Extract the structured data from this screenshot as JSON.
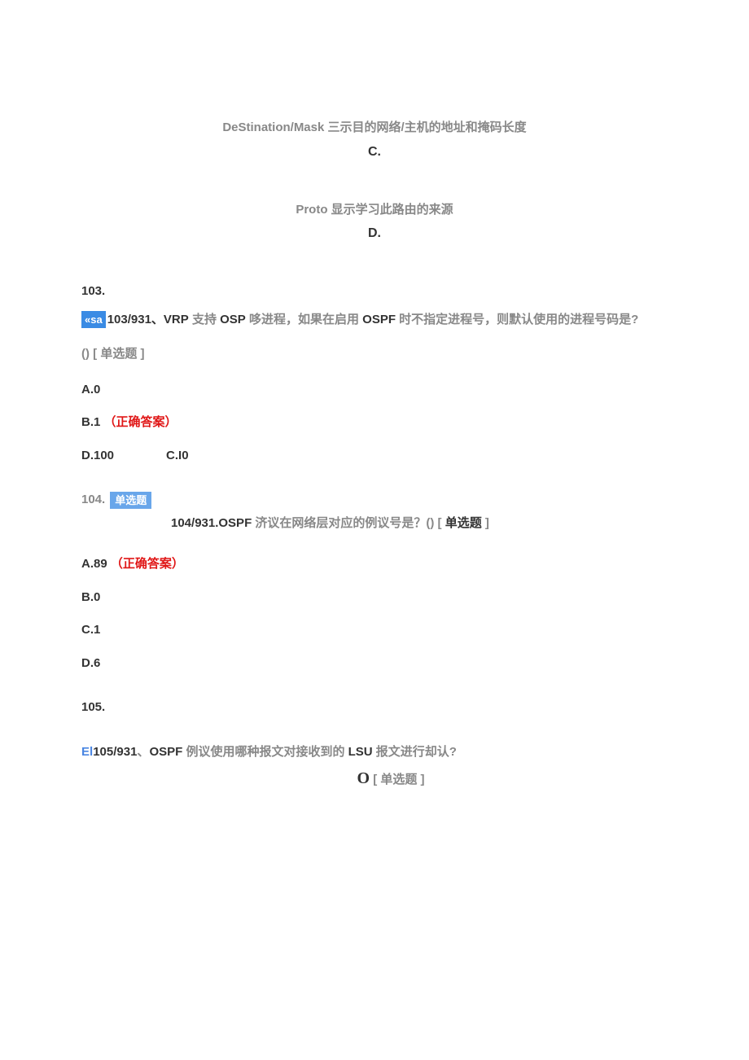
{
  "top": {
    "line1": "DeStination/Mask 三示目的网络/主机的地址和掩码长度",
    "letterC": "C.",
    "line2": "Proto 显示学习此路由的来源",
    "letterD": "D."
  },
  "q103": {
    "num": "103.",
    "tag": "«sa",
    "text_prefix": "103/931、VRP",
    "text_mid1": " 支持 ",
    "bold2": "OSP",
    "text_mid2": " 哆进程，如果在启用 ",
    "bold3": "OSPF",
    "text_tail": " 时不指定进程号，则默认使用的进程号码是?",
    "line2": "() [ 单选题 ]",
    "A": "A.0",
    "B_prefix": "B.1",
    "B_correct": "（正确答案）",
    "C": "C.I0",
    "D": "D.100"
  },
  "q104": {
    "num": "104.",
    "tag": "单选题",
    "text_bold": "104/931.OSPF",
    "text_rest": " 济议在网络层对应的例议号是？() [ ",
    "text_rest_b": "单选题",
    "text_rest_end": " ]",
    "A_prefix": "A.89",
    "A_correct": "（正确答案）",
    "B": "B.0",
    "C": "C.1",
    "D": "D.6"
  },
  "q105": {
    "num": "105.",
    "el": "El",
    "bold1": "105/931",
    "mid1": "、",
    "bold2": "OSPF",
    "mid2": " 例议使用哪种报文对接收到的 ",
    "bold3": "LSU",
    "tail": " 报文进行却认?",
    "sub_O": "O",
    "sub_text": " [ 单选题 ]"
  }
}
